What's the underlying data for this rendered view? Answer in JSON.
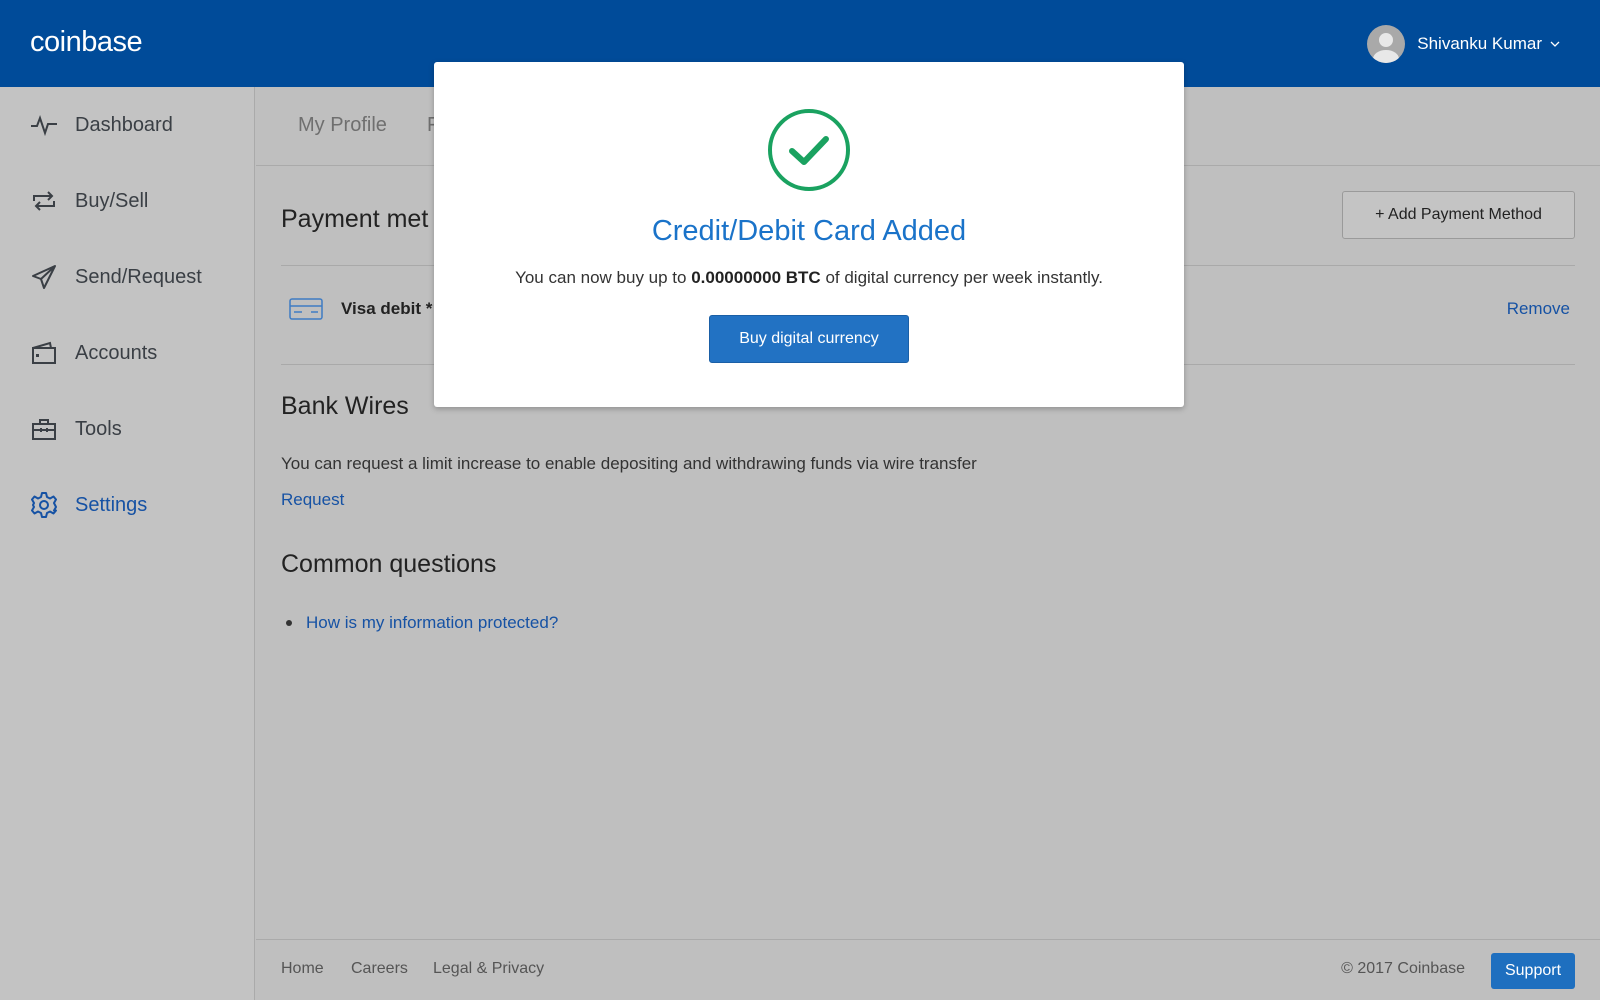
{
  "header": {
    "logo": "coinbase",
    "user_name": "Shivanku Kumar"
  },
  "sidebar": {
    "items": [
      {
        "label": "Dashboard",
        "icon": "activity-icon"
      },
      {
        "label": "Buy/Sell",
        "icon": "repeat-icon"
      },
      {
        "label": "Send/Request",
        "icon": "send-icon"
      },
      {
        "label": "Accounts",
        "icon": "wallet-icon"
      },
      {
        "label": "Tools",
        "icon": "toolbox-icon"
      },
      {
        "label": "Settings",
        "icon": "gear-icon",
        "active": true
      }
    ]
  },
  "main": {
    "tabs": [
      "My Profile",
      "F"
    ],
    "payment_title": "Payment met",
    "add_payment_label": "+ Add Payment Method",
    "card_name": "Visa debit *",
    "remove_label": "Remove",
    "bank_title": "Bank Wires",
    "bank_text": "You can request a limit increase to enable depositing and withdrawing funds via wire transfer",
    "request_label": "Request",
    "questions_title": "Common questions",
    "question_1": "How is my information protected?"
  },
  "footer": {
    "links": [
      "Home",
      "Careers",
      "Legal & Privacy"
    ],
    "copyright": "© 2017 Coinbase",
    "support_label": "Support"
  },
  "modal": {
    "title": "Credit/Debit Card Added",
    "msg_before": "You can now buy up to",
    "msg_amount": "0.00000000 BTC",
    "msg_after": "of digital currency per week instantly.",
    "button_label": "Buy digital currency"
  },
  "colors": {
    "brand_blue": "#004b99",
    "link_blue": "#1652a4",
    "success_green": "#1aa260"
  }
}
